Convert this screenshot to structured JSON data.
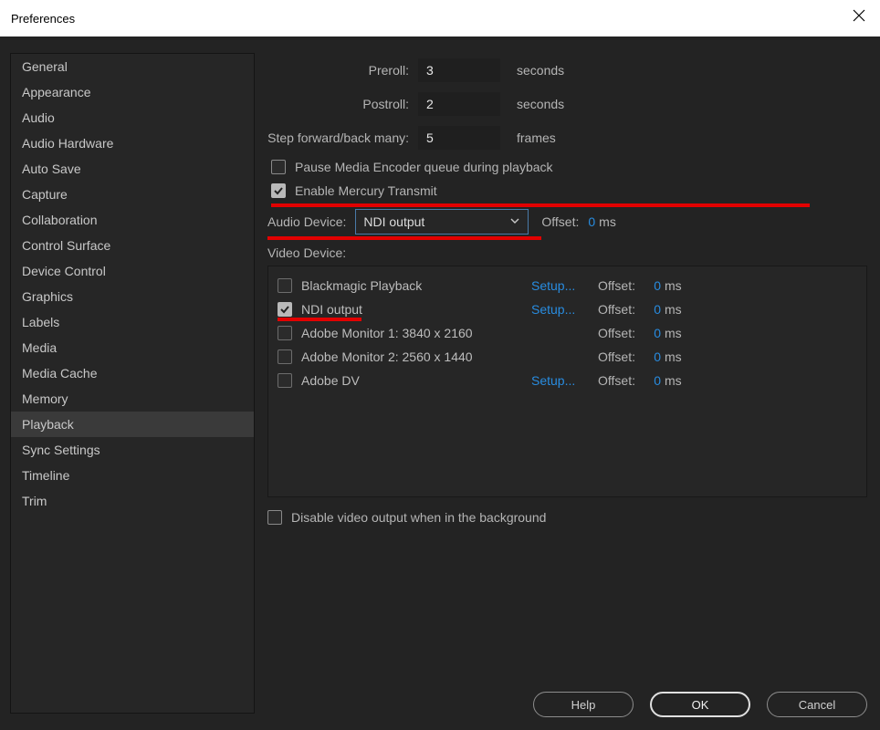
{
  "window": {
    "title": "Preferences"
  },
  "sidebar": {
    "items": [
      {
        "label": "General"
      },
      {
        "label": "Appearance"
      },
      {
        "label": "Audio"
      },
      {
        "label": "Audio Hardware"
      },
      {
        "label": "Auto Save"
      },
      {
        "label": "Capture"
      },
      {
        "label": "Collaboration"
      },
      {
        "label": "Control Surface"
      },
      {
        "label": "Device Control"
      },
      {
        "label": "Graphics"
      },
      {
        "label": "Labels"
      },
      {
        "label": "Media"
      },
      {
        "label": "Media Cache"
      },
      {
        "label": "Memory"
      },
      {
        "label": "Playback"
      },
      {
        "label": "Sync Settings"
      },
      {
        "label": "Timeline"
      },
      {
        "label": "Trim"
      }
    ],
    "selected_index": 14
  },
  "fields": {
    "preroll": {
      "label": "Preroll:",
      "value": "3",
      "unit": "seconds"
    },
    "postroll": {
      "label": "Postroll:",
      "value": "2",
      "unit": "seconds"
    },
    "step": {
      "label": "Step forward/back many:",
      "value": "5",
      "unit": "frames"
    }
  },
  "checks": {
    "pause_encoder": {
      "label": "Pause Media Encoder queue during playback",
      "checked": false
    },
    "mercury": {
      "label": "Enable Mercury Transmit",
      "checked": true
    },
    "disable_bg": {
      "label": "Disable video output when in the background",
      "checked": false
    }
  },
  "audio_device": {
    "label": "Audio Device:",
    "value": "NDI output",
    "offset_label": "Offset:",
    "offset_value": "0",
    "offset_unit": "ms"
  },
  "video_device_label": "Video Device:",
  "video_devices": [
    {
      "name": "Blackmagic Playback",
      "checked": false,
      "setup": "Setup...",
      "offset_label": "Offset:",
      "offset": "0",
      "unit": "ms"
    },
    {
      "name": "NDI output",
      "checked": true,
      "setup": "Setup...",
      "offset_label": "Offset:",
      "offset": "0",
      "unit": "ms"
    },
    {
      "name": "Adobe Monitor 1: 3840 x 2160",
      "checked": false,
      "setup": "",
      "offset_label": "Offset:",
      "offset": "0",
      "unit": "ms"
    },
    {
      "name": "Adobe Monitor 2: 2560 x 1440",
      "checked": false,
      "setup": "",
      "offset_label": "Offset:",
      "offset": "0",
      "unit": "ms"
    },
    {
      "name": "Adobe DV",
      "checked": false,
      "setup": "Setup...",
      "offset_label": "Offset:",
      "offset": "0",
      "unit": "ms"
    }
  ],
  "buttons": {
    "help": "Help",
    "ok": "OK",
    "cancel": "Cancel"
  }
}
